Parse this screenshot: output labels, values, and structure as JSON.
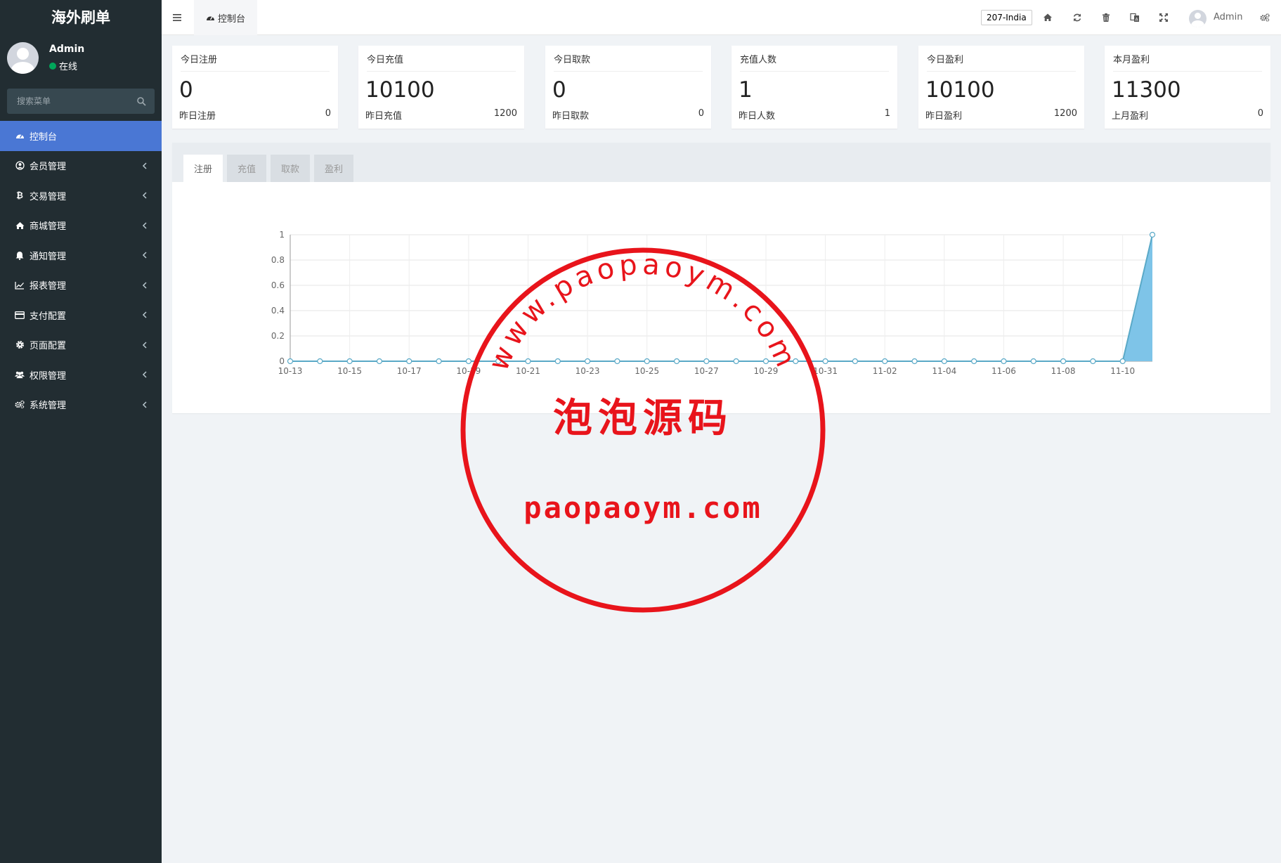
{
  "sidebar": {
    "brand": "海外刷单",
    "user": {
      "name": "Admin",
      "status": "在线"
    },
    "search": {
      "placeholder": "搜索菜单"
    },
    "menu": [
      {
        "label": "控制台",
        "icon": "dashboard-icon",
        "active": true
      },
      {
        "label": "会员管理",
        "icon": "user-circle-icon"
      },
      {
        "label": "交易管理",
        "icon": "bitcoin-icon"
      },
      {
        "label": "商城管理",
        "icon": "home-icon"
      },
      {
        "label": "通知管理",
        "icon": "bell-icon"
      },
      {
        "label": "报表管理",
        "icon": "line-chart-icon"
      },
      {
        "label": "支付配置",
        "icon": "credit-card-icon"
      },
      {
        "label": "页面配置",
        "icon": "gear-icon"
      },
      {
        "label": "权限管理",
        "icon": "users-icon"
      },
      {
        "label": "系统管理",
        "icon": "gears-icon"
      }
    ]
  },
  "header": {
    "tab": "控制台",
    "region": "207-India",
    "user": "Admin",
    "icons": [
      "menu-toggle-icon",
      "home-icon",
      "refresh-icon",
      "trash-icon",
      "language-icon",
      "fullscreen-icon",
      "settings-icon"
    ]
  },
  "stats": [
    {
      "title": "今日注册",
      "value": "0",
      "sub_label": "昨日注册",
      "sub_value": "0"
    },
    {
      "title": "今日充值",
      "value": "10100",
      "sub_label": "昨日充值",
      "sub_value": "1200"
    },
    {
      "title": "今日取款",
      "value": "0",
      "sub_label": "昨日取款",
      "sub_value": "0"
    },
    {
      "title": "充值人数",
      "value": "1",
      "sub_label": "昨日人数",
      "sub_value": "1"
    },
    {
      "title": "今日盈利",
      "value": "10100",
      "sub_label": "昨日盈利",
      "sub_value": "1200"
    },
    {
      "title": "本月盈利",
      "value": "11300",
      "sub_label": "上月盈利",
      "sub_value": "0"
    }
  ],
  "chart_tabs": [
    "注册",
    "充值",
    "取款",
    "盈利"
  ],
  "colors": {
    "sidebar": "#222d32",
    "active": "#4a77d4",
    "line": "#5aa9c7",
    "area": "#7ec4e8",
    "stamp": "#e8141b"
  },
  "chart_data": {
    "type": "area",
    "x": [
      "10-13",
      "10-14",
      "10-15",
      "10-16",
      "10-17",
      "10-18",
      "10-19",
      "10-20",
      "10-21",
      "10-22",
      "10-23",
      "10-24",
      "10-25",
      "10-26",
      "10-27",
      "10-28",
      "10-29",
      "10-30",
      "10-31",
      "11-01",
      "11-02",
      "11-03",
      "11-04",
      "11-05",
      "11-06",
      "11-07",
      "11-08",
      "11-09",
      "11-10",
      "11-11"
    ],
    "x_tick_labels": [
      "10-13",
      "10-15",
      "10-17",
      "10-19",
      "10-21",
      "10-23",
      "10-25",
      "10-27",
      "10-29",
      "10-31",
      "11-02",
      "11-04",
      "11-06",
      "11-08",
      "11-10"
    ],
    "values": [
      0,
      0,
      0,
      0,
      0,
      0,
      0,
      0,
      0,
      0,
      0,
      0,
      0,
      0,
      0,
      0,
      0,
      0,
      0,
      0,
      0,
      0,
      0,
      0,
      0,
      0,
      0,
      0,
      0,
      1
    ],
    "ylim": [
      0,
      1
    ],
    "y_ticks": [
      "0",
      "0.2",
      "0.4",
      "0.6",
      "0.8",
      "1"
    ],
    "grid": true,
    "title": "",
    "xlabel": "",
    "ylabel": ""
  },
  "watermark": {
    "top_arc": "www.paopaoym.com",
    "center": "泡泡源码",
    "bottom": "paopaoym.com"
  }
}
